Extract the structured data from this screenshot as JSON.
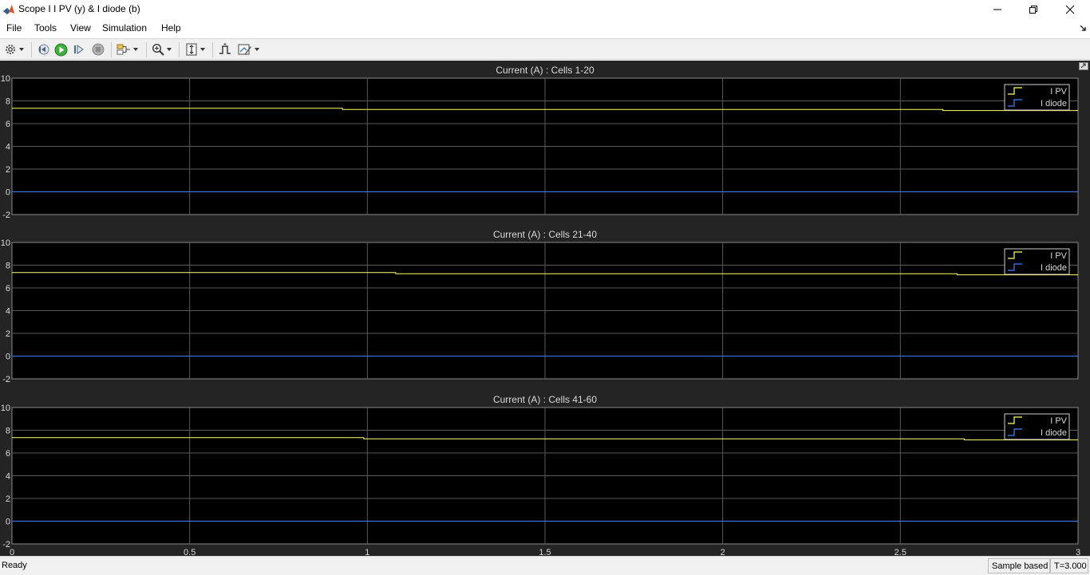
{
  "window": {
    "title": "Scope I  I PV (y) & I diode (b)",
    "icon": "matlab-icon"
  },
  "menu": [
    "File",
    "Tools",
    "View",
    "Simulation",
    "Help"
  ],
  "toolbar": {
    "buttons": [
      "settings-icon",
      "step-back-icon",
      "run-icon",
      "step-forward-icon",
      "stop-icon",
      "highlight-icon",
      "zoom-in-icon",
      "scale-axes-icon",
      "triggers-icon",
      "cursor-measurement-icon"
    ]
  },
  "plots": [
    {
      "title": "Current (A) : Cells 1-20",
      "legend": [
        "I PV",
        "I diode"
      ]
    },
    {
      "title": "Current (A) : Cells 21-40",
      "legend": [
        "I PV",
        "I diode"
      ]
    },
    {
      "title": "Current (A) : Cells 41-60",
      "legend": [
        "I PV",
        "I diode"
      ]
    }
  ],
  "colors": {
    "figure_bg": "#242424",
    "axes_bg": "#000000",
    "grid": "#5a5a5a",
    "text": "#d9d9d9",
    "ipv": "#ffff66",
    "idiode": "#3f7fff"
  },
  "chart_data": [
    {
      "type": "line",
      "title": "Current (A) : Cells 1-20",
      "xlim": [
        0,
        3
      ],
      "ylim": [
        -2,
        10
      ],
      "xticks": [
        "0",
        "0.5",
        "1",
        "1.5",
        "2",
        "2.5",
        "3"
      ],
      "yticks": [
        "-2",
        "0",
        "2",
        "4",
        "6",
        "8",
        "10"
      ],
      "grid": true,
      "legend": "top-right",
      "series": [
        {
          "name": "I PV",
          "color": "#ffff66",
          "step": true,
          "x": [
            0,
            0.93,
            2.62,
            3
          ],
          "y": [
            7.35,
            7.25,
            7.15,
            7.15
          ]
        },
        {
          "name": "I diode",
          "color": "#3f7fff",
          "step": true,
          "x": [
            0,
            3
          ],
          "y": [
            0,
            0
          ]
        }
      ]
    },
    {
      "type": "line",
      "title": "Current (A) : Cells 21-40",
      "xlim": [
        0,
        3
      ],
      "ylim": [
        -2,
        10
      ],
      "xticks": [
        "0",
        "0.5",
        "1",
        "1.5",
        "2",
        "2.5",
        "3"
      ],
      "yticks": [
        "-2",
        "0",
        "2",
        "4",
        "6",
        "8",
        "10"
      ],
      "grid": true,
      "legend": "top-right",
      "series": [
        {
          "name": "I PV",
          "color": "#ffff66",
          "step": true,
          "x": [
            0,
            1.08,
            2.66,
            3
          ],
          "y": [
            7.35,
            7.25,
            7.15,
            7.15
          ]
        },
        {
          "name": "I diode",
          "color": "#3f7fff",
          "step": true,
          "x": [
            0,
            3
          ],
          "y": [
            0,
            0
          ]
        }
      ]
    },
    {
      "type": "line",
      "title": "Current (A) : Cells 41-60",
      "xlim": [
        0,
        3
      ],
      "ylim": [
        -2,
        10
      ],
      "xticks": [
        "0",
        "0.5",
        "1",
        "1.5",
        "2",
        "2.5",
        "3"
      ],
      "yticks": [
        "-2",
        "0",
        "2",
        "4",
        "6",
        "8",
        "10"
      ],
      "grid": true,
      "legend": "top-right",
      "series": [
        {
          "name": "I PV",
          "color": "#ffff66",
          "step": true,
          "x": [
            0,
            0.99,
            2.68,
            3
          ],
          "y": [
            7.35,
            7.25,
            7.15,
            7.15
          ]
        },
        {
          "name": "I diode",
          "color": "#3f7fff",
          "step": true,
          "x": [
            0,
            3
          ],
          "y": [
            0,
            0
          ]
        }
      ]
    }
  ],
  "status": {
    "left": "Ready",
    "mode": "Sample based",
    "time": "T=3.000"
  }
}
